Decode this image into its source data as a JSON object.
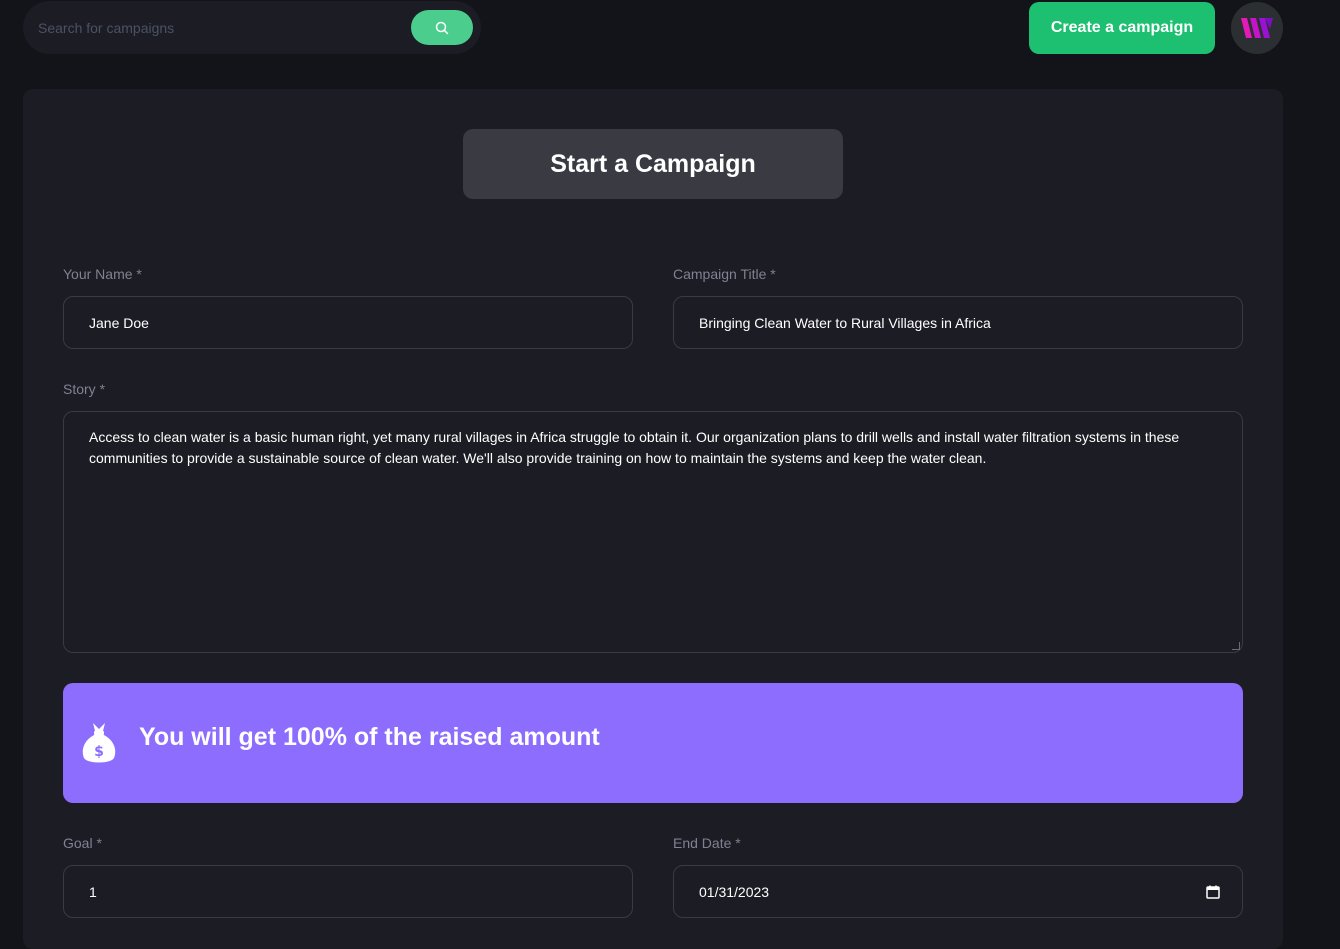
{
  "header": {
    "search_placeholder": "Search for campaigns",
    "create_button_label": "Create a campaign",
    "accent_color": "#1dc071",
    "search_button_color": "#4acd8d"
  },
  "form": {
    "title": "Start a Campaign",
    "name_label": "Your Name *",
    "name_value": "Jane Doe",
    "campaign_title_label": "Campaign Title *",
    "campaign_title_value": "Bringing Clean Water to Rural Villages in Africa",
    "story_label": "Story *",
    "story_value": "Access to clean water is a basic human right, yet many rural villages in Africa struggle to obtain it. Our organization plans to drill wells and install water filtration systems in these communities to provide a sustainable source of clean water. We'll also provide training on how to maintain the systems and keep the water clean.",
    "banner_text": "You will get 100% of the raised amount",
    "banner_color": "#8c6dfd",
    "goal_label": "Goal *",
    "goal_value": "1",
    "end_date_label": "End Date *",
    "end_date_value": "01/31/2023"
  },
  "icons": {
    "search": "search-icon",
    "logo": "logo-icon",
    "money_bag": "money-bag-icon",
    "calendar": "calendar-icon"
  }
}
